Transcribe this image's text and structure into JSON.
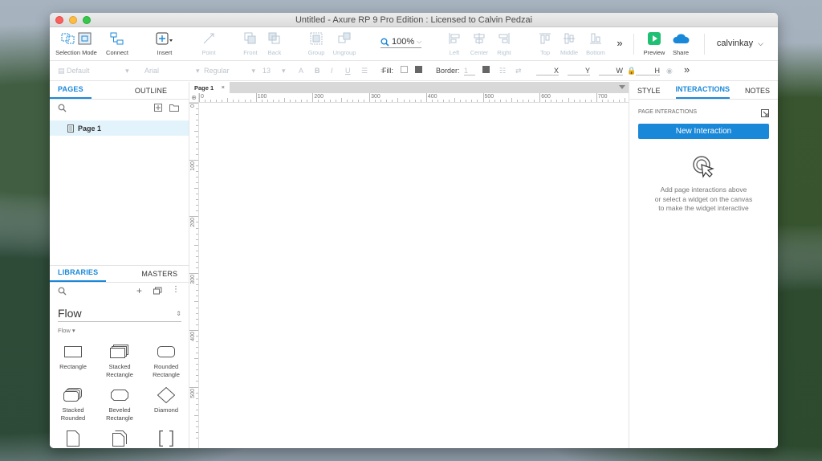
{
  "window": {
    "title": "Untitled - Axure RP 9 Pro Edition : Licensed to Calvin Pedzai"
  },
  "toolbar": {
    "selection_mode": "Selection Mode",
    "connect": "Connect",
    "insert": "Insert",
    "point": "Point",
    "front": "Front",
    "back": "Back",
    "group": "Group",
    "ungroup": "Ungroup",
    "zoom": "100%",
    "left": "Left",
    "center": "Center",
    "right": "Right",
    "top": "Top",
    "middle": "Middle",
    "bottom": "Bottom",
    "preview": "Preview",
    "share": "Share",
    "user": "calvinkay"
  },
  "stylebar": {
    "style": "Default",
    "font": "Arial",
    "weight": "Regular",
    "size": "13",
    "fill_label": "Fill:",
    "border_label": "Border:",
    "border_value": "1",
    "x": "X",
    "y": "Y",
    "w": "W",
    "h": "H"
  },
  "left_panel": {
    "tab_pages": "PAGES",
    "tab_outline": "OUTLINE",
    "page_item": "Page 1",
    "tab_libraries": "LIBRARIES",
    "tab_masters": "MASTERS",
    "library_name": "Flow",
    "library_sub": "Flow ▾",
    "widgets": [
      {
        "l1": "Rectangle",
        "l2": ""
      },
      {
        "l1": "Stacked",
        "l2": "Rectangle"
      },
      {
        "l1": "Rounded",
        "l2": "Rectangle"
      },
      {
        "l1": "Stacked",
        "l2": "Rounded"
      },
      {
        "l1": "Beveled",
        "l2": "Rectangle"
      },
      {
        "l1": "Diamond",
        "l2": ""
      }
    ]
  },
  "canvas": {
    "page_tab": "Page 1",
    "ruler_h": [
      "0",
      "100",
      "200",
      "300",
      "400",
      "500",
      "600",
      "700"
    ],
    "ruler_v": [
      "0",
      "100",
      "200",
      "300",
      "400",
      "500"
    ]
  },
  "right_panel": {
    "tab_style": "STYLE",
    "tab_interactions": "INTERACTIONS",
    "tab_notes": "NOTES",
    "page_interactions": "PAGE INTERACTIONS",
    "new_interaction": "New Interaction",
    "help_1": "Add page interactions above",
    "help_2": "or select a widget on the canvas",
    "help_3": "to make the widget interactive"
  },
  "colors": {
    "accent": "#1a88d8",
    "selected_page": "#e3f3fb",
    "preview": "#1fbf74"
  }
}
